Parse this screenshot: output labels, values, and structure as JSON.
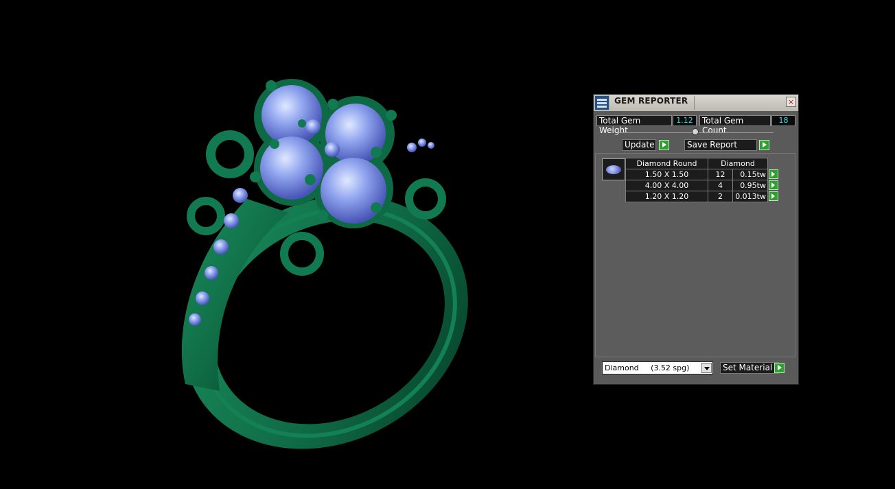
{
  "viewport": {
    "scene": "green ring with blue round gemstones"
  },
  "panel": {
    "title": "GEM REPORTER",
    "close_icon": "×",
    "total_weight_label": "Total Gem Weight",
    "total_weight_value": "1.12",
    "total_count_label": "Total Gem Count",
    "total_count_value": "18",
    "update_label": "Update",
    "save_report_label": "Save Report",
    "table": {
      "headers": [
        "Diamond Round",
        "Diamond"
      ],
      "rows": [
        {
          "size": "1.50 X 1.50",
          "count": "12",
          "weight": "0.15tw"
        },
        {
          "size": "4.00 X 4.00",
          "count": "4",
          "weight": "0.95tw"
        },
        {
          "size": "1.20 X 1.20",
          "count": "2",
          "weight": "0.013tw"
        }
      ]
    },
    "material_select_value": "Diamond     (3.52 spg)",
    "set_material_label": "Set Material"
  },
  "colors": {
    "metal": "#0f6b45",
    "gem": "#7a8fe0",
    "accent_button": "#2fa02f",
    "value_text": "#3ee0e0"
  }
}
